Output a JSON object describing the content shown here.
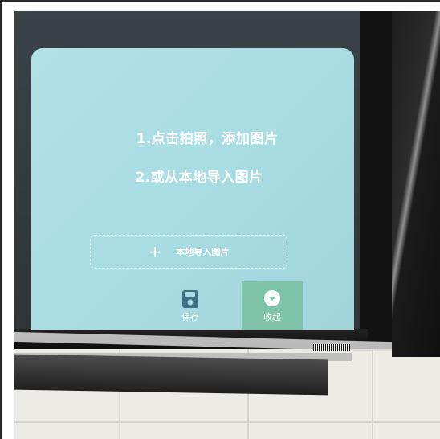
{
  "panel": {
    "instruction_1": "1.点击拍照，添加图片",
    "instruction_2": "2.或从本地导入图片",
    "import_button": {
      "icon": "plus-icon",
      "label": "本地导入图片"
    },
    "save_button": {
      "icon": "floppy-disk-icon",
      "label": "保存"
    },
    "collapse_button": {
      "icon": "chevron-down-circle-icon",
      "label": "收起"
    }
  },
  "colors": {
    "panel_background": "#a8dde3",
    "collapse_accent": "#7fc4a8",
    "text": "#ffffff"
  }
}
